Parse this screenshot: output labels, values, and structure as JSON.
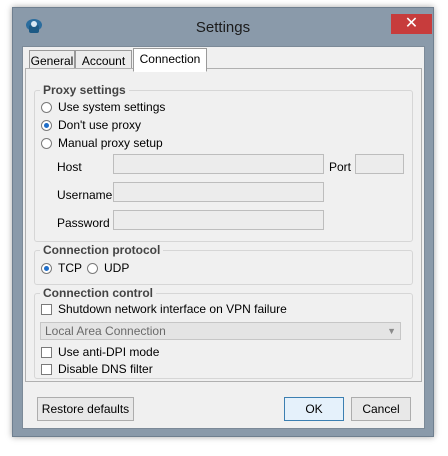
{
  "window": {
    "title": "Settings",
    "close_glyph": "✕"
  },
  "tabs": [
    {
      "label": "General"
    },
    {
      "label": "Account"
    },
    {
      "label": "Connection"
    }
  ],
  "proxy": {
    "title": "Proxy settings",
    "options": [
      "Use system settings",
      "Don't use proxy",
      "Manual proxy setup"
    ],
    "selected": "Don't use proxy",
    "host_label": "Host",
    "port_label": "Port",
    "username_label": "Username",
    "password_label": "Password",
    "host_value": "",
    "port_value": "",
    "username_value": "",
    "password_value": ""
  },
  "protocol": {
    "title": "Connection protocol",
    "options": [
      "TCP",
      "UDP"
    ],
    "selected": "TCP"
  },
  "control": {
    "title": "Connection control",
    "shutdown_label": "Shutdown network interface on VPN failure",
    "shutdown_checked": false,
    "adapter_value": "Local Area Connection",
    "anti_dpi_label": "Use anti-DPI mode",
    "anti_dpi_checked": false,
    "dns_label": "Disable DNS filter",
    "dns_checked": false
  },
  "buttons": {
    "restore": "Restore defaults",
    "ok": "OK",
    "cancel": "Cancel"
  },
  "colors": {
    "accent": "#1f6ec9",
    "close": "#c73c3c",
    "frame": "#8a9aaa"
  }
}
